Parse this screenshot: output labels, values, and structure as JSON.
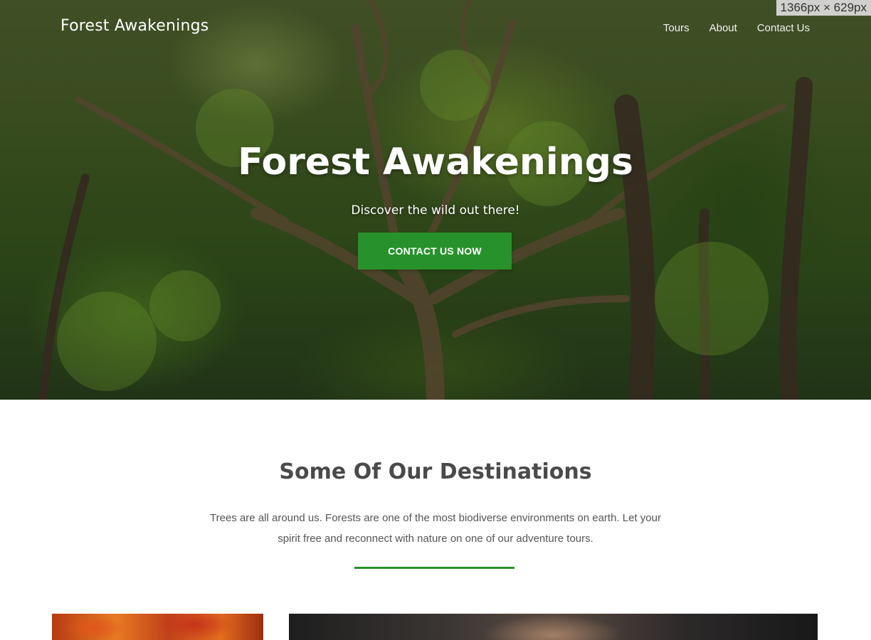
{
  "viewport_badge": "1366px × 629px",
  "header": {
    "brand": "Forest Awakenings",
    "nav": [
      "Tours",
      "About",
      "Contact Us"
    ]
  },
  "hero": {
    "title": "Forest Awakenings",
    "subtitle": "Discover the wild out there!",
    "cta_label": "CONTACT US NOW"
  },
  "destinations": {
    "title": "Some Of Our Destinations",
    "description": "Trees are all around us. Forests are one of the most biodiverse environments on earth. Let your spirit free and reconnect with nature on one of our adventure tours."
  },
  "colors": {
    "accent": "#27922b",
    "text_heading": "#4a4a4a",
    "text_body": "#555555"
  }
}
